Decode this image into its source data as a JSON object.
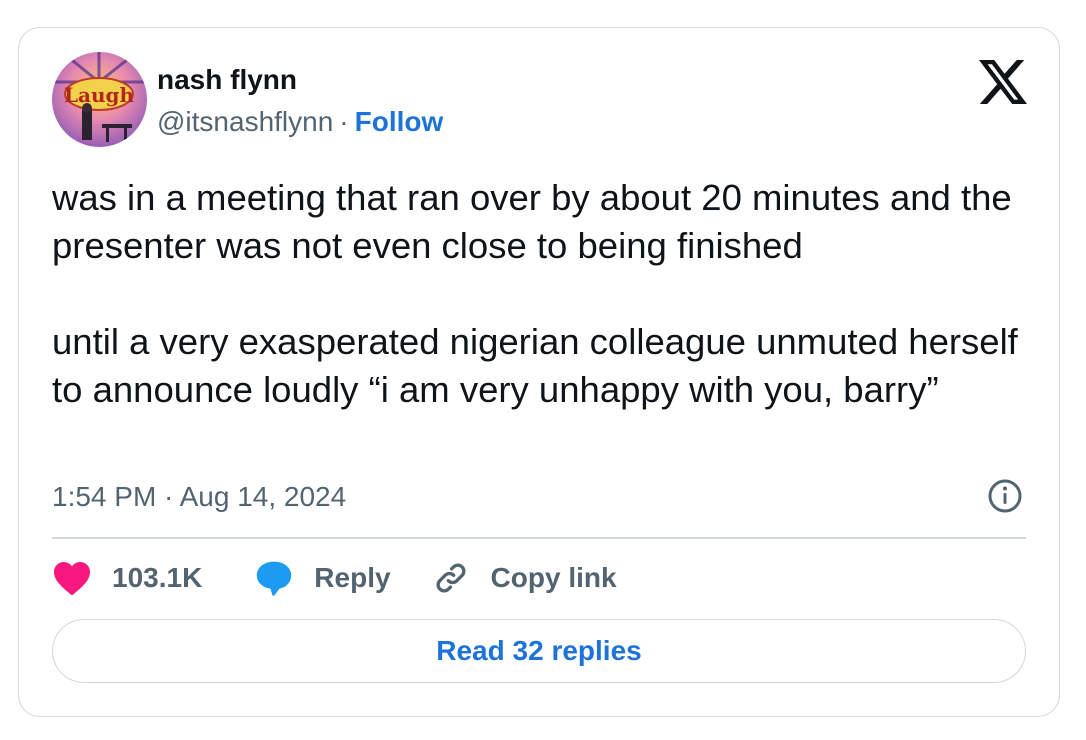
{
  "author": {
    "name": "nash flynn",
    "handle": "@itsnashflynn",
    "separator": "·",
    "follow_label": "Follow",
    "avatar_logo_text": "Laugh"
  },
  "tweet": {
    "text": "was in a meeting that ran over by about 20 minutes and the presenter was not even close to being finished\n\nuntil a very exasperated nigerian colleague unmuted herself to announce loudly “i am very unhappy with you, barry”",
    "timestamp": "1:54 PM · Aug 14, 2024"
  },
  "actions": {
    "like_count": "103.1K",
    "reply_label": "Reply",
    "copy_link_label": "Copy link"
  },
  "footer": {
    "read_replies_label": "Read 32 replies"
  },
  "colors": {
    "link_blue": "#1d73d7",
    "like_pink": "#f91880",
    "reply_blue": "#1d9bf0",
    "muted_gray": "#536471",
    "border": "#cfd9de"
  },
  "icons": {
    "brand": "x-logo-icon",
    "info": "info-icon",
    "like": "heart-icon",
    "reply": "speech-bubble-icon",
    "copy_link": "link-icon"
  }
}
